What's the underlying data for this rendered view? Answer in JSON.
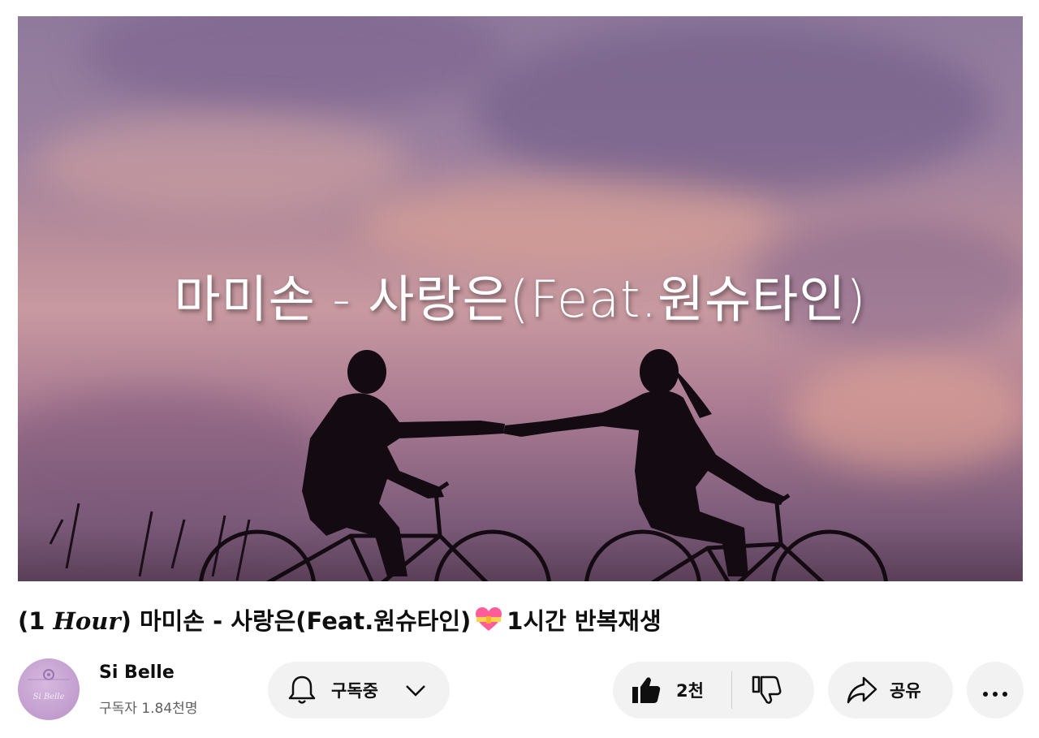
{
  "player": {
    "overlay_title": "마미손 - 사랑은(Feat.원슈타인)"
  },
  "video": {
    "title_prefix_open": "(1 ",
    "title_hour": "Hour",
    "title_main": ") 마미손 - 사랑은(Feat.원슈타인)",
    "title_emoji_icon": "heart-with-ribbon-icon",
    "title_suffix": "1시간 반복재생"
  },
  "channel": {
    "name": "Si Belle",
    "subscribers": "구독자 1.84천명",
    "avatar_text": "Si Belle"
  },
  "actions": {
    "subscribe_label": "구독중",
    "like_count": "2천",
    "share_label": "공유"
  },
  "colors": {
    "pill_background": "#f2f2f2",
    "text_primary": "#0f0f0f",
    "text_secondary": "#606060"
  }
}
